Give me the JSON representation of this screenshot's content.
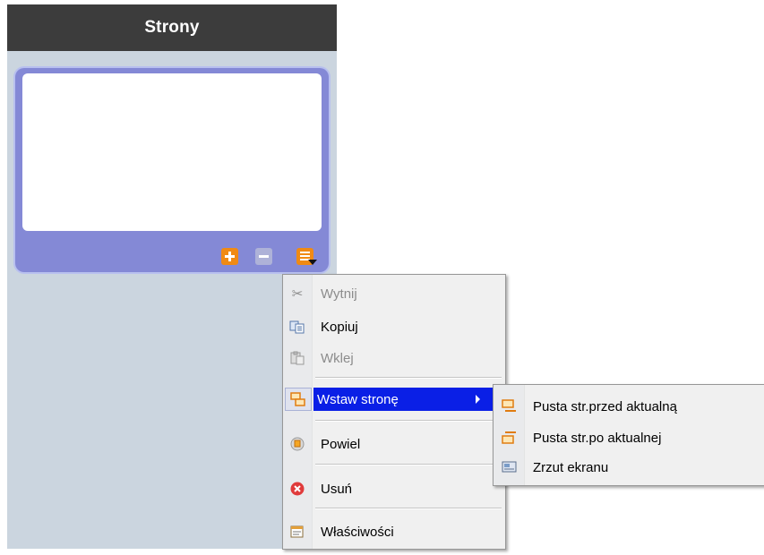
{
  "panel": {
    "title": "Strony"
  },
  "thumbnail_toolbar": {
    "add_icon": "plus-icon",
    "remove_icon": "minus-icon",
    "menu_icon": "menu-list-icon"
  },
  "context_menu": {
    "items": [
      {
        "label": "Wytnij",
        "icon": "scissors-icon",
        "enabled": false
      },
      {
        "label": "Kopiuj",
        "icon": "copy-icon",
        "enabled": true
      },
      {
        "label": "Wklej",
        "icon": "paste-icon",
        "enabled": false
      },
      {
        "label": "Wstaw stronę",
        "icon": "insert-page-icon",
        "enabled": true,
        "submenu": true,
        "highlighted": true
      },
      {
        "label": "Powiel",
        "icon": "duplicate-icon",
        "enabled": true
      },
      {
        "label": "Usuń",
        "icon": "delete-icon",
        "enabled": true
      },
      {
        "label": "Właściwości",
        "icon": "properties-icon",
        "enabled": true
      }
    ]
  },
  "submenu": {
    "items": [
      {
        "label": "Pusta str.przed aktualną",
        "icon": "page-before-icon"
      },
      {
        "label": "Pusta str.po aktualnej",
        "icon": "page-after-icon"
      },
      {
        "label": "Zrzut ekranu",
        "icon": "screenshot-icon"
      }
    ]
  },
  "colors": {
    "header_bg": "#3c3c3c",
    "panel_bg": "#cbd5df",
    "thumb_frame": "#8489d6",
    "highlight": "#0a1fe6",
    "accent_orange": "#f08a14"
  }
}
